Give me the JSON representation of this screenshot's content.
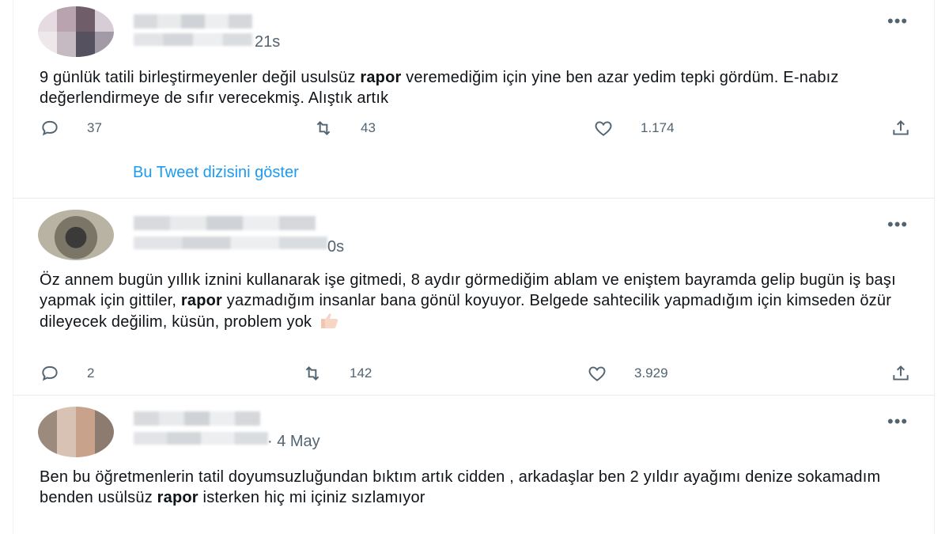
{
  "tweets": [
    {
      "time": "21s",
      "text_parts": [
        "9 günlük tatili birleştirmeyenler değil usulsüz ",
        "rapor",
        " veremediğim için yine ben azar yedim tepki gördüm. E-nabız değerlendirmeye de sıfır verecekmiş. Alıştık artık"
      ],
      "replies": "37",
      "retweets": "43",
      "likes": "1.174",
      "show_thread": "Bu Tweet dizisini göster"
    },
    {
      "time": "0s",
      "text_parts": [
        "Öz annem bugün yıllık iznini kullanarak işe gitmedi, 8 aydır görmediğim ablam ve eniştem bayramda gelip bugün iş başı yapmak için gittiler, ",
        "rapor",
        " yazmadığım insanlar bana gönül koyuyor. Belgede sahtecilik yapmadığım için kimseden özür dileyecek değilim, küsün, problem yok "
      ],
      "emoji": "thumbs-up",
      "replies": "2",
      "retweets": "142",
      "likes": "3.929"
    },
    {
      "time": "· 4 May",
      "text_parts": [
        "Ben bu öğretmenlerin tatil doyumsuzluğundan bıktım artık cidden , arkadaşlar ben 2 yıldır ayağımı denize sokamadım benden usülsüz ",
        "rapor",
        " isterken hiç mi içiniz sızlamıyor"
      ]
    }
  ],
  "more_label": "•••",
  "colors": {
    "link": "#1d9bf0",
    "secondary": "#536471",
    "divider": "#e6ecf0"
  }
}
